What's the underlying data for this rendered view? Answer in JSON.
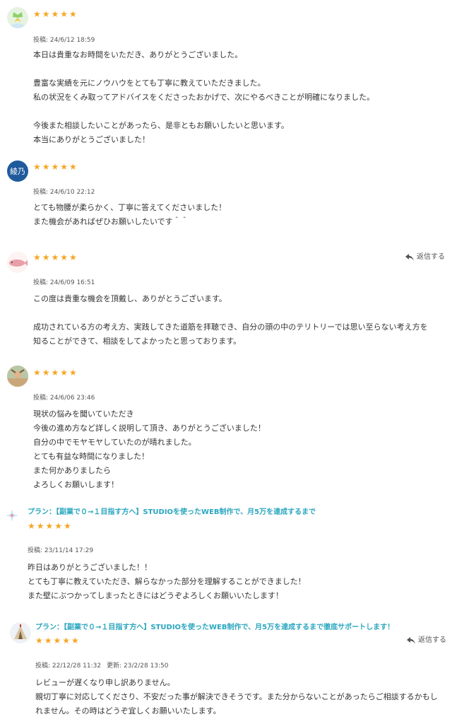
{
  "reviews": [
    {
      "stars": "★★★★★",
      "posted": "投稿: 24/6/12 18:59",
      "lines": [
        "本日は貴重なお時間をいただき、ありがとうございました。",
        "",
        "豊富な実績を元にノウハウをとても丁寧に教えていただきました。",
        "私の状況をくみ取ってアドバイスをくださったおかげで、次にやるべきことが明確になりました。",
        "",
        "今後また相談したいことがあったら、是非ともお願いしたいと思います。",
        "本当にありがとうございました！"
      ]
    },
    {
      "avatar_text": "綾乃",
      "stars": "★★★★★",
      "posted": "投稿: 24/6/10 22:12",
      "lines": [
        "とても物腰が柔らかく、丁寧に答えてくださいました！",
        "また機会があればぜひお願いしたいです＾＾"
      ]
    },
    {
      "stars": "★★★★★",
      "reply_label": "返信する",
      "posted": "投稿: 24/6/09 16:51",
      "lines": [
        "この度は貴重な機会を頂戴し、ありがとうございます。",
        "",
        "成功されている方の考え方、実践してきた道筋を拝聴でき、自分の頭の中のテリトリーでは思い至らない考え方を",
        "知ることができて、相談をしてよかったと思っております。"
      ]
    },
    {
      "stars": "★★★★★",
      "posted": "投稿: 24/6/06 23:46",
      "lines": [
        "現状の悩みを聞いていただき",
        "今後の進め方など詳しく説明して頂き、ありがとうございました！",
        "自分の中でモヤモヤしていたのが晴れました。",
        "とても有益な時間になりました！",
        "また何かありましたら",
        "よろしくお願いします！"
      ]
    },
    {
      "plan": "プラン：【副業で０→１目指す方へ】STUDIOを使ったWEB制作で、月5万を達成するまで",
      "stars": "★★★★★",
      "posted": "投稿: 23/11/14 17:29",
      "lines": [
        "昨日はありがとうございました！！",
        "とても丁寧に教えていただき、解らなかった部分を理解することができました！",
        "また壁にぶつかってしまったときにはどうぞよろしくお願いいたします！"
      ]
    },
    {
      "plan": "プラン：【副業で０→１目指す方へ】STUDIOを使ったWEB制作で、月5万を達成するまで徹底サポートします！",
      "stars": "★★★★★",
      "reply_label": "返信する",
      "posted": "投稿: 22/12/28 11:32",
      "updated": "更新: 23/2/28 13:50",
      "lines": [
        "レビューが遅くなり申し訳ありません。",
        "親切丁寧に対応してくださり、不安だった事が解決できそうです。また分からないことがあったらご相談するかもし",
        "れません。その時はどうぞ宜しくお願いいたします。"
      ]
    }
  ],
  "colors": {
    "star": "#f5a623",
    "plan": "#2aa6bf",
    "avatar_blue": "#1f5a9c"
  }
}
